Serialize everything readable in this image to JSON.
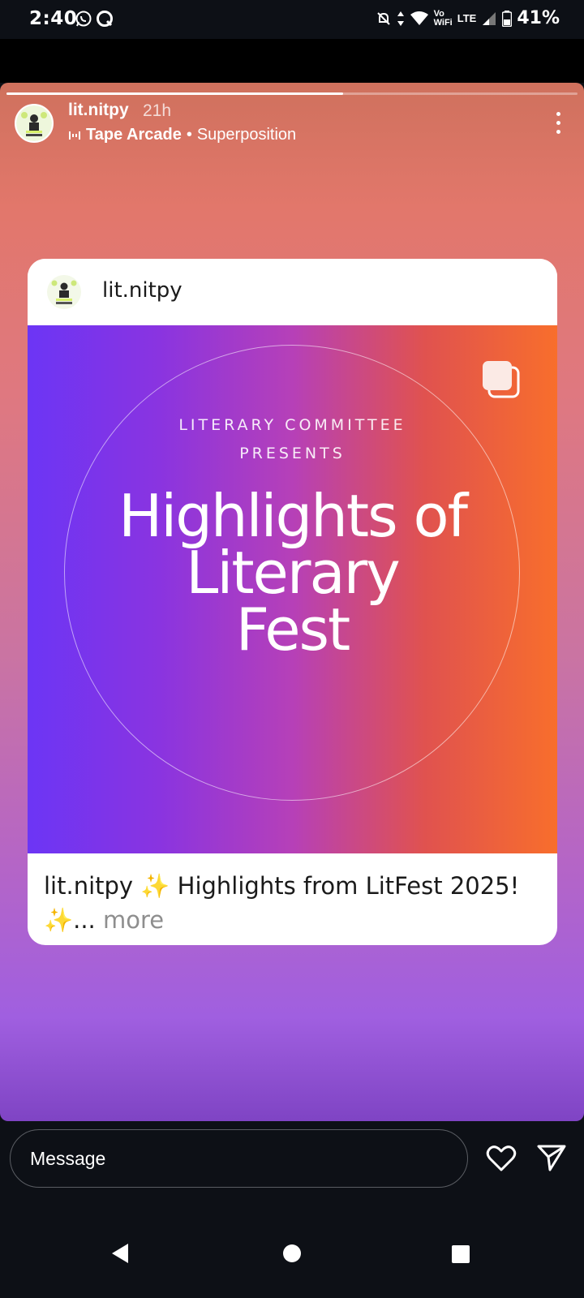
{
  "status_bar": {
    "time": "2:40",
    "left_icons": [
      "whatsapp-icon",
      "chat-icon"
    ],
    "right_icons": [
      "mute-icon",
      "data-arrows-icon",
      "wifi-icon",
      "signal-icon",
      "battery-icon"
    ],
    "vowifi_line1": "Vo",
    "vowifi_line2": "WiFi",
    "lte": "LTE",
    "battery_percent": "41%"
  },
  "story": {
    "progress_fraction": 0.59,
    "username": "lit.nitpy",
    "time_ago": "21h",
    "music": {
      "track": "Tape Arcade",
      "separator": "•",
      "artist": "Superposition"
    },
    "more_options_icon": "more-vertical-icon"
  },
  "shared_post": {
    "username": "lit.nitpy",
    "multi_image_icon": "carousel-icon",
    "image": {
      "subtitle_line1": "LITERARY COMMITTEE",
      "subtitle_line2": "PRESENTS",
      "title_line1": "Highlights of",
      "title_line2": "Literary",
      "title_line3": "Fest"
    },
    "caption": {
      "user": "lit.nitpy",
      "text": "✨ Highlights from LitFest 2025! ✨...",
      "more": "more"
    }
  },
  "reply_bar": {
    "placeholder": "Message",
    "like_icon": "heart-icon",
    "share_icon": "send-icon"
  },
  "nav_bar": {
    "icons": [
      "back-icon",
      "home-icon",
      "recents-icon"
    ]
  },
  "colors": {
    "story_top": "#cf715d",
    "story_bottom": "#7f44c4",
    "image_left": "#6c35f5",
    "image_right": "#f86e2c"
  }
}
